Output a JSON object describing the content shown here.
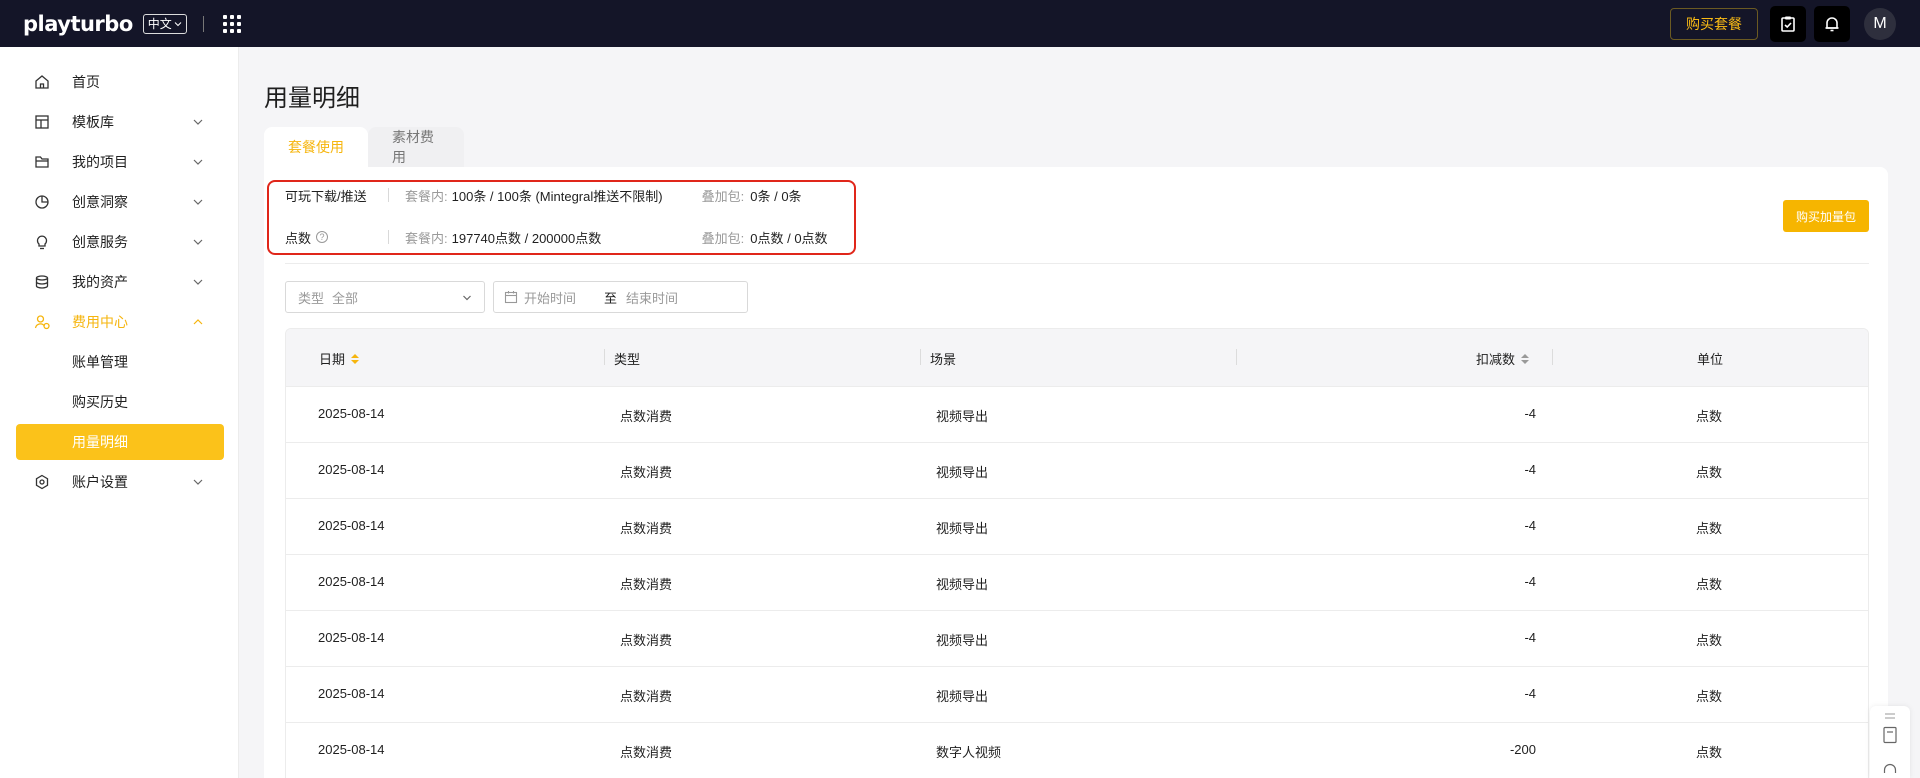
{
  "header": {
    "logo": "playturbo",
    "language": "中文",
    "buy_plan": "购买套餐",
    "avatar_initial": "M"
  },
  "sidebar": {
    "items": [
      {
        "label": "首页",
        "icon": "home-icon"
      },
      {
        "label": "模板库",
        "icon": "template-icon"
      },
      {
        "label": "我的项目",
        "icon": "folder-icon"
      },
      {
        "label": "创意洞察",
        "icon": "pie-chart-icon"
      },
      {
        "label": "创意服务",
        "icon": "bulb-icon"
      },
      {
        "label": "我的资产",
        "icon": "database-icon"
      },
      {
        "label": "费用中心",
        "icon": "user-money-icon"
      },
      {
        "label": "账单管理"
      },
      {
        "label": "购买历史"
      },
      {
        "label": "用量明细"
      },
      {
        "label": "账户设置",
        "icon": "settings-hex-icon"
      }
    ]
  },
  "page": {
    "title": "用量明细",
    "tabs": [
      "套餐使用",
      "素材费用"
    ]
  },
  "summary": {
    "rows": [
      {
        "name": "可玩下载/推送",
        "in_plan_label": "套餐内:",
        "in_plan_value": "100条 / 100条 (Mintegral推送不限制)",
        "addon_label": "叠加包:",
        "addon_value": "0条 / 0条"
      },
      {
        "name": "点数",
        "in_plan_label": "套餐内:",
        "in_plan_value": "197740点数 / 200000点数",
        "addon_label": "叠加包:",
        "addon_value": "0点数 / 0点数"
      }
    ],
    "buy_addon": "购买加量包"
  },
  "filters": {
    "type_label": "类型",
    "type_value": "全部",
    "start_placeholder": "开始时间",
    "to": "至",
    "end_placeholder": "结束时间"
  },
  "table": {
    "columns": [
      "日期",
      "类型",
      "场景",
      "扣减数",
      "单位"
    ],
    "rows": [
      [
        "2025-08-14",
        "点数消费",
        "视频导出",
        "-4",
        "点数"
      ],
      [
        "2025-08-14",
        "点数消费",
        "视频导出",
        "-4",
        "点数"
      ],
      [
        "2025-08-14",
        "点数消费",
        "视频导出",
        "-4",
        "点数"
      ],
      [
        "2025-08-14",
        "点数消费",
        "视频导出",
        "-4",
        "点数"
      ],
      [
        "2025-08-14",
        "点数消费",
        "视频导出",
        "-4",
        "点数"
      ],
      [
        "2025-08-14",
        "点数消费",
        "视频导出",
        "-4",
        "点数"
      ],
      [
        "2025-08-14",
        "点数消费",
        "数字人视频",
        "-200",
        "点数"
      ]
    ]
  },
  "colors": {
    "accent": "#fbc21a",
    "topbar": "#141528",
    "highlight_box": "#e0261a"
  }
}
